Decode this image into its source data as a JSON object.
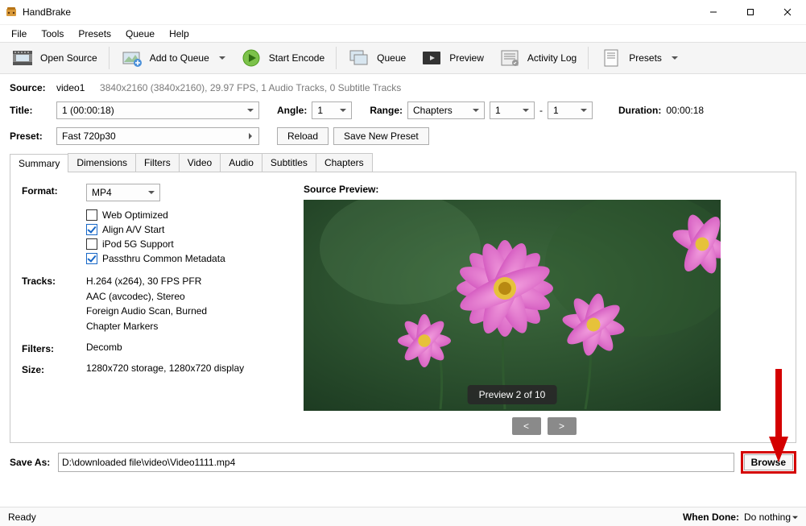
{
  "app": {
    "title": "HandBrake"
  },
  "menu": {
    "file": "File",
    "tools": "Tools",
    "presets": "Presets",
    "queue": "Queue",
    "help": "Help"
  },
  "toolbar": {
    "open_source": "Open Source",
    "add_queue": "Add to Queue",
    "start_encode": "Start Encode",
    "queue": "Queue",
    "preview": "Preview",
    "activity_log": "Activity Log",
    "presets": "Presets"
  },
  "source": {
    "label": "Source:",
    "name": "video1",
    "details": "3840x2160 (3840x2160), 29.97 FPS, 1 Audio Tracks, 0 Subtitle Tracks"
  },
  "titleRow": {
    "title_label": "Title:",
    "title_value": "1  (00:00:18)",
    "angle_label": "Angle:",
    "angle_value": "1",
    "range_label": "Range:",
    "range_mode": "Chapters",
    "range_from": "1",
    "range_sep": "-",
    "range_to": "1",
    "duration_label": "Duration:",
    "duration_value": "00:00:18"
  },
  "presetRow": {
    "label": "Preset:",
    "value": "Fast 720p30",
    "reload": "Reload",
    "save_new": "Save New Preset"
  },
  "tabs": {
    "summary": "Summary",
    "dimensions": "Dimensions",
    "filters": "Filters",
    "video": "Video",
    "audio": "Audio",
    "subtitles": "Subtitles",
    "chapters": "Chapters"
  },
  "summary": {
    "format_label": "Format:",
    "format_value": "MP4",
    "chk_web": "Web Optimized",
    "chk_av": "Align A/V Start",
    "chk_ipod": "iPod 5G Support",
    "chk_meta": "Passthru Common Metadata",
    "tracks_label": "Tracks:",
    "track_lines": [
      "H.264 (x264), 30 FPS PFR",
      "AAC (avcodec), Stereo",
      "Foreign Audio Scan, Burned",
      "Chapter Markers"
    ],
    "filters_label": "Filters:",
    "filters_value": "Decomb",
    "size_label": "Size:",
    "size_value": "1280x720 storage, 1280x720 display",
    "preview_label": "Source Preview:",
    "preview_badge": "Preview 2 of 10",
    "prev": "<",
    "next": ">"
  },
  "saveas": {
    "label": "Save As:",
    "path": "D:\\downloaded file\\video\\Video1111.mp4",
    "browse": "Browse"
  },
  "status": {
    "ready": "Ready",
    "when_done_label": "When Done:",
    "when_done_value": "Do nothing"
  }
}
